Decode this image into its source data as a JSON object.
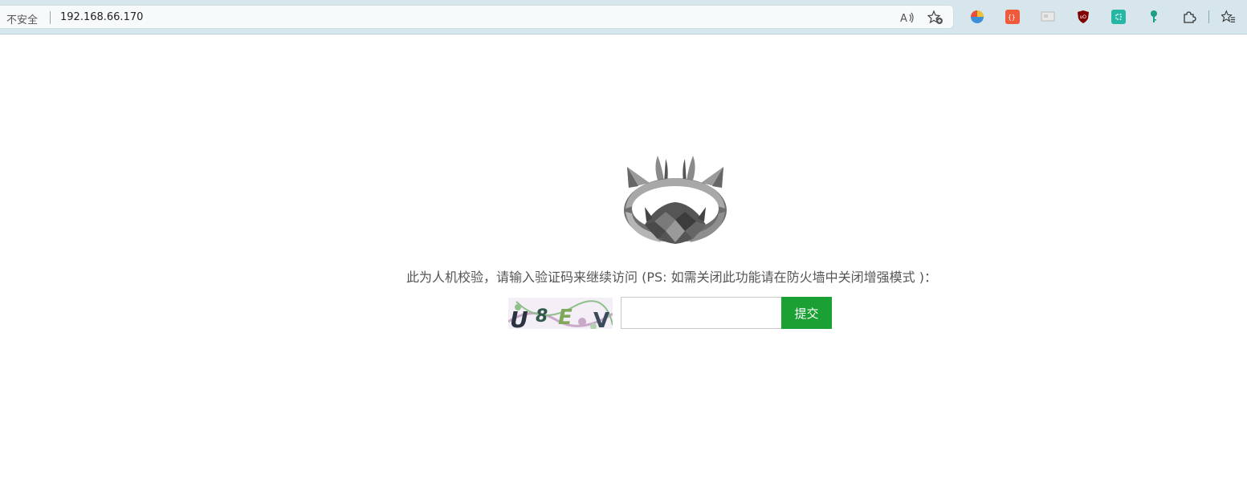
{
  "browser": {
    "security_label": "不安全",
    "url": "192.168.66.170",
    "icons": {
      "read_aloud": "read-aloud-icon",
      "favorite": "add-favorite-icon",
      "extensions": [
        "ext-colorful-icon",
        "ext-json-icon",
        "ext-gray-icon",
        "ext-ublock-icon",
        "ext-teal-icon",
        "ext-key-icon",
        "extensions-puzzle-icon",
        "favorites-list-icon"
      ]
    },
    "accent_color": "#d6e6ec"
  },
  "page": {
    "prompt": "此为人机校验，请输入验证码来继续访问 (PS: 如需关闭此功能请在防火墙中关闭增强模式 )：",
    "captcha_text": "U8EV",
    "input_value": "",
    "input_placeholder": "",
    "submit_label": "提交",
    "submit_color": "#1aa033"
  }
}
